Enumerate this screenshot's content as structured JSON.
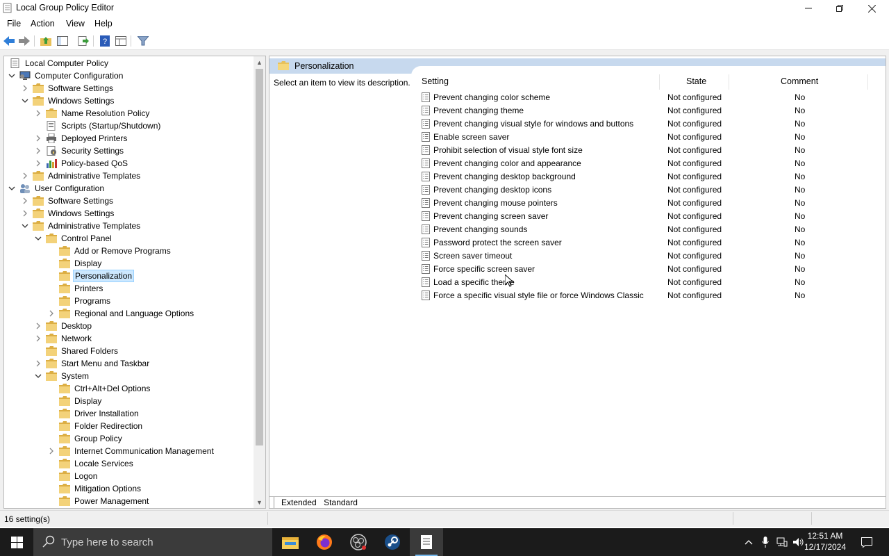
{
  "window": {
    "title": "Local Group Policy Editor"
  },
  "menu": [
    "File",
    "Action",
    "View",
    "Help"
  ],
  "tree": [
    {
      "label": "Local Computer Policy",
      "icon": "computer-policy-icon",
      "level": 0,
      "expander": "",
      "selected": false
    },
    {
      "label": "Computer Configuration",
      "icon": "computer-icon",
      "level": 0,
      "expander": "open",
      "selected": false
    },
    {
      "label": "Software Settings",
      "icon": "folder-icon",
      "level": 1,
      "expander": "closed",
      "selected": false
    },
    {
      "label": "Windows Settings",
      "icon": "folder-icon",
      "level": 1,
      "expander": "open",
      "selected": false
    },
    {
      "label": "Name Resolution Policy",
      "icon": "folder-icon",
      "level": 2,
      "expander": "closed",
      "selected": false
    },
    {
      "label": "Scripts (Startup/Shutdown)",
      "icon": "scripts-icon",
      "level": 2,
      "expander": "",
      "selected": false
    },
    {
      "label": "Deployed Printers",
      "icon": "printer-icon",
      "level": 2,
      "expander": "closed",
      "selected": false
    },
    {
      "label": "Security Settings",
      "icon": "security-icon",
      "level": 2,
      "expander": "closed",
      "selected": false
    },
    {
      "label": "Policy-based QoS",
      "icon": "qos-chart-icon",
      "level": 2,
      "expander": "closed",
      "selected": false
    },
    {
      "label": "Administrative Templates",
      "icon": "folder-icon",
      "level": 1,
      "expander": "closed",
      "selected": false
    },
    {
      "label": "User Configuration",
      "icon": "users-icon",
      "level": 0,
      "expander": "open",
      "selected": false
    },
    {
      "label": "Software Settings",
      "icon": "folder-icon",
      "level": 1,
      "expander": "closed",
      "selected": false
    },
    {
      "label": "Windows Settings",
      "icon": "folder-icon",
      "level": 1,
      "expander": "closed",
      "selected": false
    },
    {
      "label": "Administrative Templates",
      "icon": "folder-icon",
      "level": 1,
      "expander": "open",
      "selected": false
    },
    {
      "label": "Control Panel",
      "icon": "folder-icon",
      "level": 2,
      "expander": "open",
      "selected": false
    },
    {
      "label": "Add or Remove Programs",
      "icon": "folder-icon",
      "level": 3,
      "expander": "",
      "selected": false
    },
    {
      "label": "Display",
      "icon": "folder-icon",
      "level": 3,
      "expander": "",
      "selected": false
    },
    {
      "label": "Personalization",
      "icon": "folder-icon",
      "level": 3,
      "expander": "",
      "selected": true
    },
    {
      "label": "Printers",
      "icon": "folder-icon",
      "level": 3,
      "expander": "",
      "selected": false
    },
    {
      "label": "Programs",
      "icon": "folder-icon",
      "level": 3,
      "expander": "",
      "selected": false
    },
    {
      "label": "Regional and Language Options",
      "icon": "folder-icon",
      "level": 3,
      "expander": "closed",
      "selected": false
    },
    {
      "label": "Desktop",
      "icon": "folder-icon",
      "level": 2,
      "expander": "closed",
      "selected": false
    },
    {
      "label": "Network",
      "icon": "folder-icon",
      "level": 2,
      "expander": "closed",
      "selected": false
    },
    {
      "label": "Shared Folders",
      "icon": "folder-icon",
      "level": 2,
      "expander": "",
      "selected": false
    },
    {
      "label": "Start Menu and Taskbar",
      "icon": "folder-icon",
      "level": 2,
      "expander": "closed",
      "selected": false
    },
    {
      "label": "System",
      "icon": "folder-icon",
      "level": 2,
      "expander": "open",
      "selected": false
    },
    {
      "label": "Ctrl+Alt+Del Options",
      "icon": "folder-icon",
      "level": 3,
      "expander": "",
      "selected": false
    },
    {
      "label": "Display",
      "icon": "folder-icon",
      "level": 3,
      "expander": "",
      "selected": false
    },
    {
      "label": "Driver Installation",
      "icon": "folder-icon",
      "level": 3,
      "expander": "",
      "selected": false
    },
    {
      "label": "Folder Redirection",
      "icon": "folder-icon",
      "level": 3,
      "expander": "",
      "selected": false
    },
    {
      "label": "Group Policy",
      "icon": "folder-icon",
      "level": 3,
      "expander": "",
      "selected": false
    },
    {
      "label": "Internet Communication Management",
      "icon": "folder-icon",
      "level": 3,
      "expander": "closed",
      "selected": false
    },
    {
      "label": "Locale Services",
      "icon": "folder-icon",
      "level": 3,
      "expander": "",
      "selected": false
    },
    {
      "label": "Logon",
      "icon": "folder-icon",
      "level": 3,
      "expander": "",
      "selected": false
    },
    {
      "label": "Mitigation Options",
      "icon": "folder-icon",
      "level": 3,
      "expander": "",
      "selected": false
    },
    {
      "label": "Power Management",
      "icon": "folder-icon",
      "level": 3,
      "expander": "",
      "selected": false
    }
  ],
  "right": {
    "header": "Personalization",
    "description": "Select an item to view its description.",
    "columns": {
      "setting": "Setting",
      "state": "State",
      "comment": "Comment"
    },
    "rows": [
      {
        "setting": "Prevent changing color scheme",
        "state": "Not configured",
        "comment": "No"
      },
      {
        "setting": "Prevent changing theme",
        "state": "Not configured",
        "comment": "No"
      },
      {
        "setting": "Prevent changing visual style for windows and buttons",
        "state": "Not configured",
        "comment": "No"
      },
      {
        "setting": "Enable screen saver",
        "state": "Not configured",
        "comment": "No"
      },
      {
        "setting": "Prohibit selection of visual style font size",
        "state": "Not configured",
        "comment": "No"
      },
      {
        "setting": "Prevent changing color and appearance",
        "state": "Not configured",
        "comment": "No"
      },
      {
        "setting": "Prevent changing desktop background",
        "state": "Not configured",
        "comment": "No"
      },
      {
        "setting": "Prevent changing desktop icons",
        "state": "Not configured",
        "comment": "No"
      },
      {
        "setting": "Prevent changing mouse pointers",
        "state": "Not configured",
        "comment": "No"
      },
      {
        "setting": "Prevent changing screen saver",
        "state": "Not configured",
        "comment": "No"
      },
      {
        "setting": "Prevent changing sounds",
        "state": "Not configured",
        "comment": "No"
      },
      {
        "setting": "Password protect the screen saver",
        "state": "Not configured",
        "comment": "No"
      },
      {
        "setting": "Screen saver timeout",
        "state": "Not configured",
        "comment": "No"
      },
      {
        "setting": "Force specific screen saver",
        "state": "Not configured",
        "comment": "No"
      },
      {
        "setting": "Load a specific theme",
        "state": "Not configured",
        "comment": "No"
      },
      {
        "setting": "Force a specific visual style file or force Windows Classic",
        "state": "Not configured",
        "comment": "No"
      }
    ],
    "tabs": {
      "extended": "Extended",
      "standard": "Standard"
    }
  },
  "status": {
    "text": "16 setting(s)"
  },
  "taskbar": {
    "search_placeholder": "Type here to search",
    "time": "12:51 AM",
    "date": "12/17/2024",
    "apps": [
      "file-explorer-icon",
      "firefox-icon",
      "obs-icon",
      "steam-icon",
      "notepad-icon"
    ]
  },
  "colors": {
    "selection": "#cce8ff",
    "header_band": "#c7d9ee",
    "taskbar": "#1b1b1b",
    "folder": "#e8c15a"
  }
}
